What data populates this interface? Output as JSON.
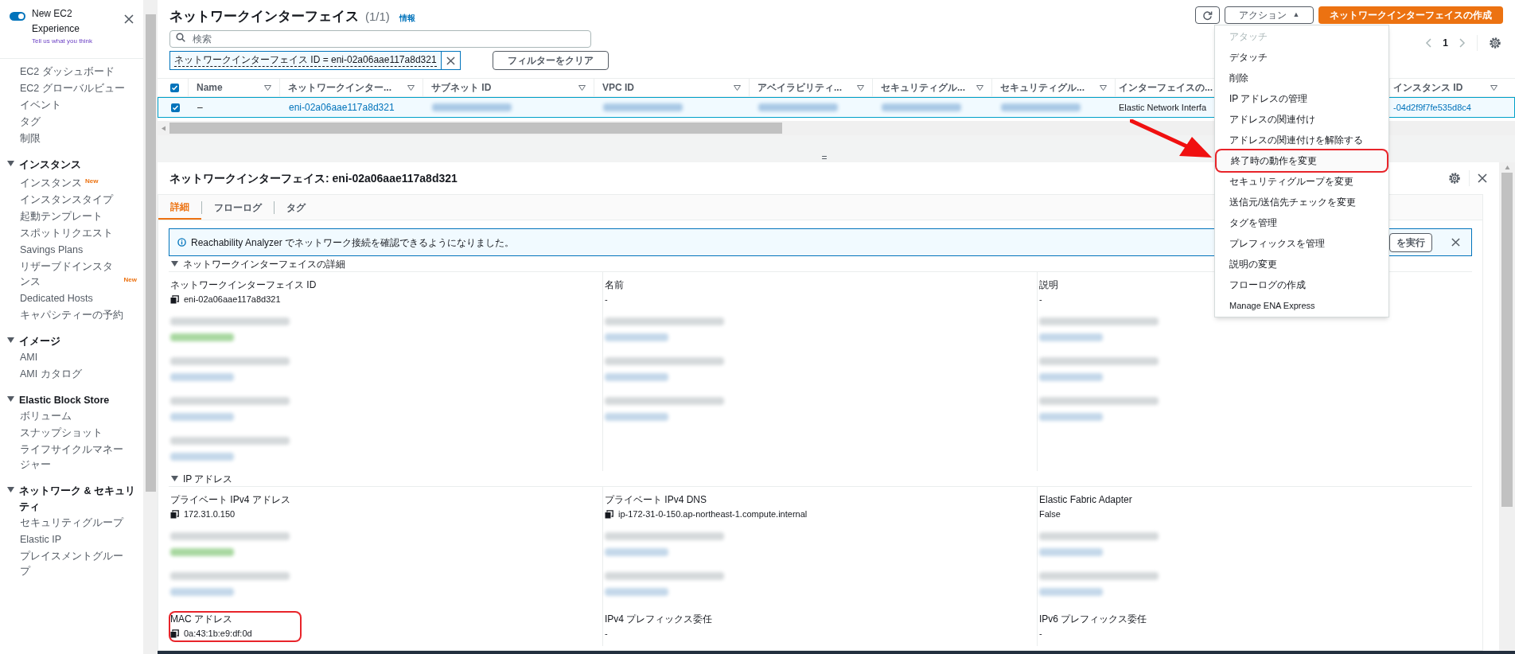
{
  "sidebar": {
    "toggle": {
      "on": true,
      "label": "New EC2 Experience",
      "feedback": "Tell us what you think"
    },
    "sections": [
      {
        "items": [
          {
            "label": "EC2 ダッシュボード"
          },
          {
            "label": "EC2 グローバルビュー"
          },
          {
            "label": "イベント"
          },
          {
            "label": "タグ"
          },
          {
            "label": "制限"
          }
        ]
      },
      {
        "title": "インスタンス",
        "items": [
          {
            "label": "インスタンス",
            "badge": "New"
          },
          {
            "label": "インスタンスタイプ"
          },
          {
            "label": "起動テンプレート"
          },
          {
            "label": "スポットリクエスト"
          },
          {
            "label": "Savings Plans"
          },
          {
            "label": "リザーブドインスタンス",
            "badge": "New"
          },
          {
            "label": "Dedicated Hosts"
          },
          {
            "label": "キャパシティーの予約"
          }
        ]
      },
      {
        "title": "イメージ",
        "items": [
          {
            "label": "AMI"
          },
          {
            "label": "AMI カタログ"
          }
        ]
      },
      {
        "title": "Elastic Block Store",
        "items": [
          {
            "label": "ボリューム"
          },
          {
            "label": "スナップショット"
          },
          {
            "label": "ライフサイクルマネージャー"
          }
        ]
      },
      {
        "title": "ネットワーク & セキュリティ",
        "items": [
          {
            "label": "セキュリティグループ"
          },
          {
            "label": "Elastic IP"
          },
          {
            "label": "プレイスメントグループ"
          }
        ]
      }
    ]
  },
  "header": {
    "title": "ネットワークインターフェイス",
    "count": "(1/1)",
    "info": "情報",
    "search_placeholder": "検索",
    "filter_token": "ネットワークインターフェイス ID = eni-02a06aae117a8d321",
    "clear_filters": "フィルターをクリア",
    "actions": "アクション",
    "actions_caret": "▲",
    "create": "ネットワークインターフェイスの作成",
    "page": "1"
  },
  "table": {
    "all_selected": true,
    "columns": [
      {
        "label": "Name"
      },
      {
        "label": "ネットワークインター..."
      },
      {
        "label": "サブネット ID"
      },
      {
        "label": "VPC ID"
      },
      {
        "label": "アベイラビリティ..."
      },
      {
        "label": "セキュリティグル..."
      },
      {
        "label": "セキュリティグル..."
      },
      {
        "label": "インターフェイスの..."
      },
      {
        "label": "インスタンス ID"
      }
    ],
    "rows": [
      {
        "selected": true,
        "cells": [
          {
            "kind": "text",
            "text": "–"
          },
          {
            "kind": "link",
            "text": "eni-02a06aae117a8d321"
          },
          {
            "kind": "redacted"
          },
          {
            "kind": "redacted"
          },
          {
            "kind": "redacted"
          },
          {
            "kind": "redacted"
          },
          {
            "kind": "redacted"
          },
          {
            "kind": "text",
            "text": "Elastic Network Interfa"
          },
          {
            "kind": "link",
            "text": "-04d2f9f7fe535d8c4"
          }
        ]
      }
    ]
  },
  "actions_menu": [
    {
      "label": "アタッチ",
      "disabled": true,
      "highlighted": false
    },
    {
      "label": "デタッチ",
      "disabled": false,
      "highlighted": false
    },
    {
      "label": "削除",
      "disabled": false,
      "highlighted": false
    },
    {
      "label": "IP アドレスの管理",
      "disabled": false,
      "highlighted": false
    },
    {
      "label": "アドレスの関連付け",
      "disabled": false,
      "highlighted": false
    },
    {
      "label": "アドレスの関連付けを解除する",
      "disabled": false,
      "highlighted": false
    },
    {
      "label": "終了時の動作を変更",
      "disabled": false,
      "highlighted": true
    },
    {
      "label": "セキュリティグループを変更",
      "disabled": false,
      "highlighted": false
    },
    {
      "label": "送信元/送信先チェックを変更",
      "disabled": false,
      "highlighted": false
    },
    {
      "label": "タグを管理",
      "disabled": false,
      "highlighted": false
    },
    {
      "label": "プレフィックスを管理",
      "disabled": false,
      "highlighted": false
    },
    {
      "label": "説明の変更",
      "disabled": false,
      "highlighted": false
    },
    {
      "label": "フローログの作成",
      "disabled": false,
      "highlighted": false
    },
    {
      "label": "Manage ENA Express",
      "disabled": false,
      "highlighted": false
    }
  ],
  "detail": {
    "title": "ネットワークインターフェイス: eni-02a06aae117a8d321",
    "resize_handle": "=",
    "tabs": [
      {
        "label": "詳細",
        "selected": true
      },
      {
        "label": "フローログ",
        "selected": false
      },
      {
        "label": "タグ",
        "selected": false
      }
    ],
    "banner": {
      "text": "Reachability Analyzer でネットワーク接続を確認できるようになりました。",
      "button": "を実行"
    },
    "sections": [
      {
        "title": "ネットワークインターフェイスの詳細",
        "fields": [
          {
            "kind": "text",
            "label": "ネットワークインターフェイス ID",
            "value": "eni-02a06aae117a8d321",
            "copy": true,
            "highlighted": false
          },
          {
            "kind": "text",
            "label": "名前",
            "value": "-",
            "copy": false,
            "highlighted": false
          },
          {
            "kind": "text",
            "label": "説明",
            "value": "-",
            "copy": false,
            "highlighted": false
          },
          {
            "kind": "redacted"
          },
          {
            "kind": "redacted"
          },
          {
            "kind": "redacted"
          },
          {
            "kind": "redacted"
          },
          {
            "kind": "redacted"
          },
          {
            "kind": "redacted"
          },
          {
            "kind": "redacted"
          },
          {
            "kind": "redacted"
          },
          {
            "kind": "redacted"
          },
          {
            "kind": "redacted"
          },
          {
            "kind": "empty"
          },
          {
            "kind": "empty"
          }
        ]
      },
      {
        "title": "IP アドレス",
        "fields": [
          {
            "kind": "text",
            "label": "プライベート IPv4 アドレス",
            "value": "172.31.0.150",
            "copy": true,
            "highlighted": false
          },
          {
            "kind": "text",
            "label": "プライベート IPv4 DNS",
            "value": "ip-172-31-0-150.ap-northeast-1.compute.internal",
            "copy": true,
            "highlighted": false
          },
          {
            "kind": "text",
            "label": "Elastic Fabric Adapter",
            "value": "False",
            "copy": false,
            "highlighted": false
          },
          {
            "kind": "redacted"
          },
          {
            "kind": "redacted"
          },
          {
            "kind": "redacted"
          },
          {
            "kind": "redacted"
          },
          {
            "kind": "redacted"
          },
          {
            "kind": "redacted"
          },
          {
            "kind": "text",
            "label": "MAC アドレス",
            "value": "0a:43:1b:e9:df:0d",
            "copy": true,
            "highlighted": true
          },
          {
            "kind": "text",
            "label": "IPv4 プレフィックス委任",
            "value": "-",
            "copy": false,
            "highlighted": false
          },
          {
            "kind": "text",
            "label": "IPv6 プレフィックス委任",
            "value": "-",
            "copy": false,
            "highlighted": false
          }
        ]
      }
    ]
  }
}
